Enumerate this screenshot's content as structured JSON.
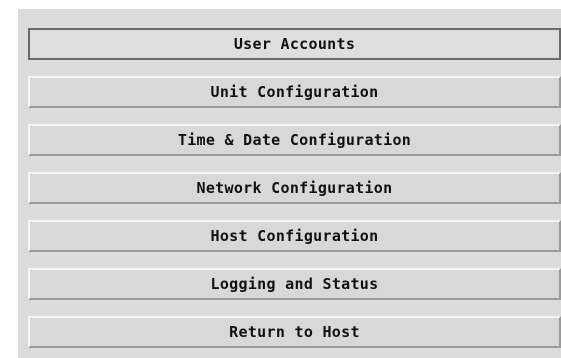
{
  "menu": {
    "items": [
      {
        "label": "User Accounts",
        "selected": true
      },
      {
        "label": "Unit Configuration",
        "selected": false
      },
      {
        "label": "Time & Date Configuration",
        "selected": false
      },
      {
        "label": "Network Configuration",
        "selected": false
      },
      {
        "label": "Host Configuration",
        "selected": false
      },
      {
        "label": "Logging and Status",
        "selected": false
      },
      {
        "label": "Return to Host",
        "selected": false
      }
    ]
  },
  "colors": {
    "panel_background": "#dcdcdc",
    "button_face": "#d8d8d8",
    "text": "#111111"
  }
}
